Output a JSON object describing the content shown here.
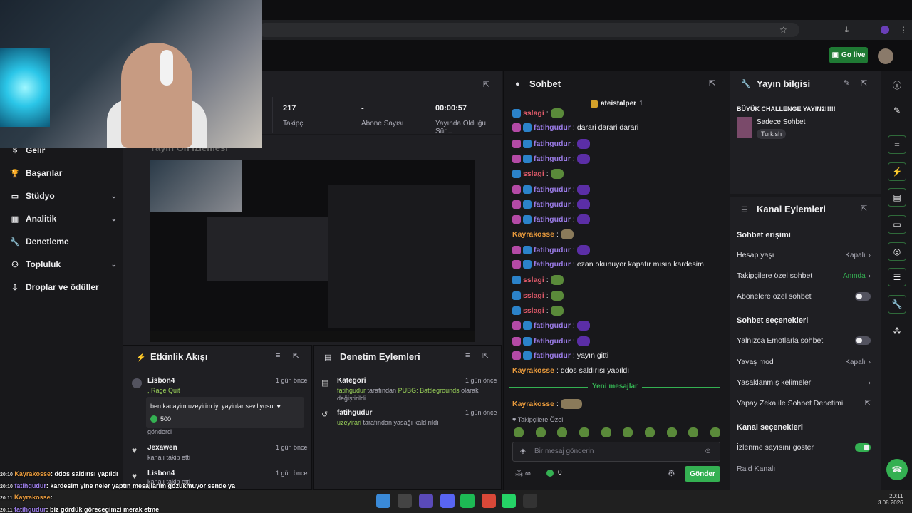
{
  "app": {
    "go_live": "Go live"
  },
  "sidebar": {
    "items": [
      {
        "label": "Gelir",
        "icon": "dollar-icon"
      },
      {
        "label": "Başarılar",
        "icon": "trophy-icon"
      },
      {
        "label": "Stüdyo",
        "icon": "studio-icon"
      },
      {
        "label": "Analitik",
        "icon": "chart-icon"
      },
      {
        "label": "Denetleme",
        "icon": "wrench-icon"
      },
      {
        "label": "Topluluk",
        "icon": "community-icon"
      },
      {
        "label": "Droplar ve ödüller",
        "icon": "drops-icon"
      }
    ]
  },
  "stats": {
    "followers_value": "217",
    "followers_label": "Takipçi",
    "subs_value": "-",
    "subs_label": "Abone Sayısı",
    "time_value": "00:00:57",
    "time_label": "Yayında Olduğu Sür..."
  },
  "preview": {
    "title": "Yayın Ön İzlemesi"
  },
  "activity": {
    "title": "Etkinlik Akışı",
    "items": [
      {
        "user": "Lisbon4",
        "time": "1 gün önce",
        "sub": ", Rage Quit",
        "message": "ben kacayim uzeyirim iyi yayinlar seviliyosun♥",
        "points": "500",
        "footer": "gönderdi"
      },
      {
        "user": "Jexawen",
        "time": "1 gün önce",
        "sub": "kanalı takip etti"
      },
      {
        "user": "Lisbon4",
        "time": "1 gün önce",
        "sub": "kanalı takip etti"
      }
    ]
  },
  "moderation": {
    "title": "Denetim Eylemleri",
    "items": [
      {
        "title": "Kategori",
        "time": "1 gün önce",
        "user": "fatihgudur",
        "text": " tarafından ",
        "highlight": "PUBG: Battlegrounds",
        "text2": " olarak değiştirildi"
      },
      {
        "title": "fatihgudur",
        "time": "1 gün önce",
        "user": "uzeyirari",
        "text": " tarafından yasağı kaldırıldı"
      }
    ]
  },
  "chat": {
    "title": "Sohbet",
    "pinned_user": "ateistalper",
    "pinned_count": "1",
    "messages": [
      {
        "user": "sslagi",
        "color": "#e05a6a",
        "text": ""
      },
      {
        "user": "fatihgudur",
        "color": "#9b7ce8",
        "text": "darari darari darari"
      },
      {
        "user": "fatihgudur",
        "color": "#9b7ce8",
        "text": ""
      },
      {
        "user": "fatihgudur",
        "color": "#9b7ce8",
        "text": ""
      },
      {
        "user": "sslagi",
        "color": "#e05a6a",
        "text": ""
      },
      {
        "user": "fatihgudur",
        "color": "#9b7ce8",
        "text": ""
      },
      {
        "user": "fatihgudur",
        "color": "#9b7ce8",
        "text": ""
      },
      {
        "user": "fatihgudur",
        "color": "#9b7ce8",
        "text": ""
      },
      {
        "user": "Kayrakosse",
        "color": "#e89a3c",
        "text": ""
      },
      {
        "user": "fatihgudur",
        "color": "#9b7ce8",
        "text": ""
      },
      {
        "user": "fatihgudur",
        "color": "#9b7ce8",
        "text": "ezan okunuyor kapatır mısın kardesim"
      },
      {
        "user": "sslagi",
        "color": "#e05a6a",
        "text": ""
      },
      {
        "user": "sslagi",
        "color": "#e05a6a",
        "text": ""
      },
      {
        "user": "sslagi",
        "color": "#e05a6a",
        "text": ""
      },
      {
        "user": "fatihgudur",
        "color": "#9b7ce8",
        "text": ""
      },
      {
        "user": "fatihgudur",
        "color": "#9b7ce8",
        "text": ""
      },
      {
        "user": "fatihgudur",
        "color": "#9b7ce8",
        "text": "yayın gitti"
      },
      {
        "user": "Kayrakosse",
        "color": "#e89a3c",
        "text": "ddos saldırısı yapıldı"
      }
    ],
    "new_messages": "Yeni mesajlar",
    "last_user": "Kayrakosse",
    "follower_only": "Takipçilere Özel",
    "input_placeholder": "Bir mesaj gönderin",
    "points": "0",
    "send": "Gönder"
  },
  "stream_info": {
    "title": "Yayın bilgisi",
    "stream_title": "BÜYÜK CHALLENGE YAYIN2!!!!!",
    "category": "Sadece Sohbet",
    "tag": "Turkish"
  },
  "channel_actions": {
    "title": "Kanal Eylemleri",
    "chat_access": "Sohbet erişimi",
    "account_age": "Hesap yaşı",
    "account_age_val": "Kapalı",
    "followers_chat": "Takipçilere özel sohbet",
    "followers_chat_val": "Anında",
    "subs_chat": "Abonelere özel sohbet",
    "chat_options": "Sohbet seçenekleri",
    "emote_only": "Yalnızca Emotlarla sohbet",
    "slow_mode": "Yavaş mod",
    "slow_mode_val": "Kapalı",
    "banned_words": "Yasaklanmış kelimeler",
    "ai_mod": "Yapay Zeka ile Sohbet Denetimi",
    "channel_options": "Kanal seçenekleri",
    "show_viewers": "İzlenme sayısını göster",
    "raid": "Raid Kanalı"
  },
  "overlay_chat": [
    {
      "time": "20:10",
      "user": "Kayrakosse",
      "text": ": ddos saldırısı yapıldı",
      "color": "#e89a3c"
    },
    {
      "time": "20:10",
      "user": "fatihgudur",
      "text": ": kardesim yine neler yaptın mesajlarım gozukmuyor sende ya",
      "color": "#9b7ce8"
    },
    {
      "time": "20:11",
      "user": "Kayrakosse",
      "text": ":",
      "color": "#e89a3c"
    },
    {
      "time": "20:11",
      "user": "fatihgudur",
      "text": ": biz gördük görecegimzi merak etme",
      "color": "#9b7ce8"
    }
  ],
  "taskbar": {
    "time": "20:11",
    "date": "3.08.2026"
  }
}
